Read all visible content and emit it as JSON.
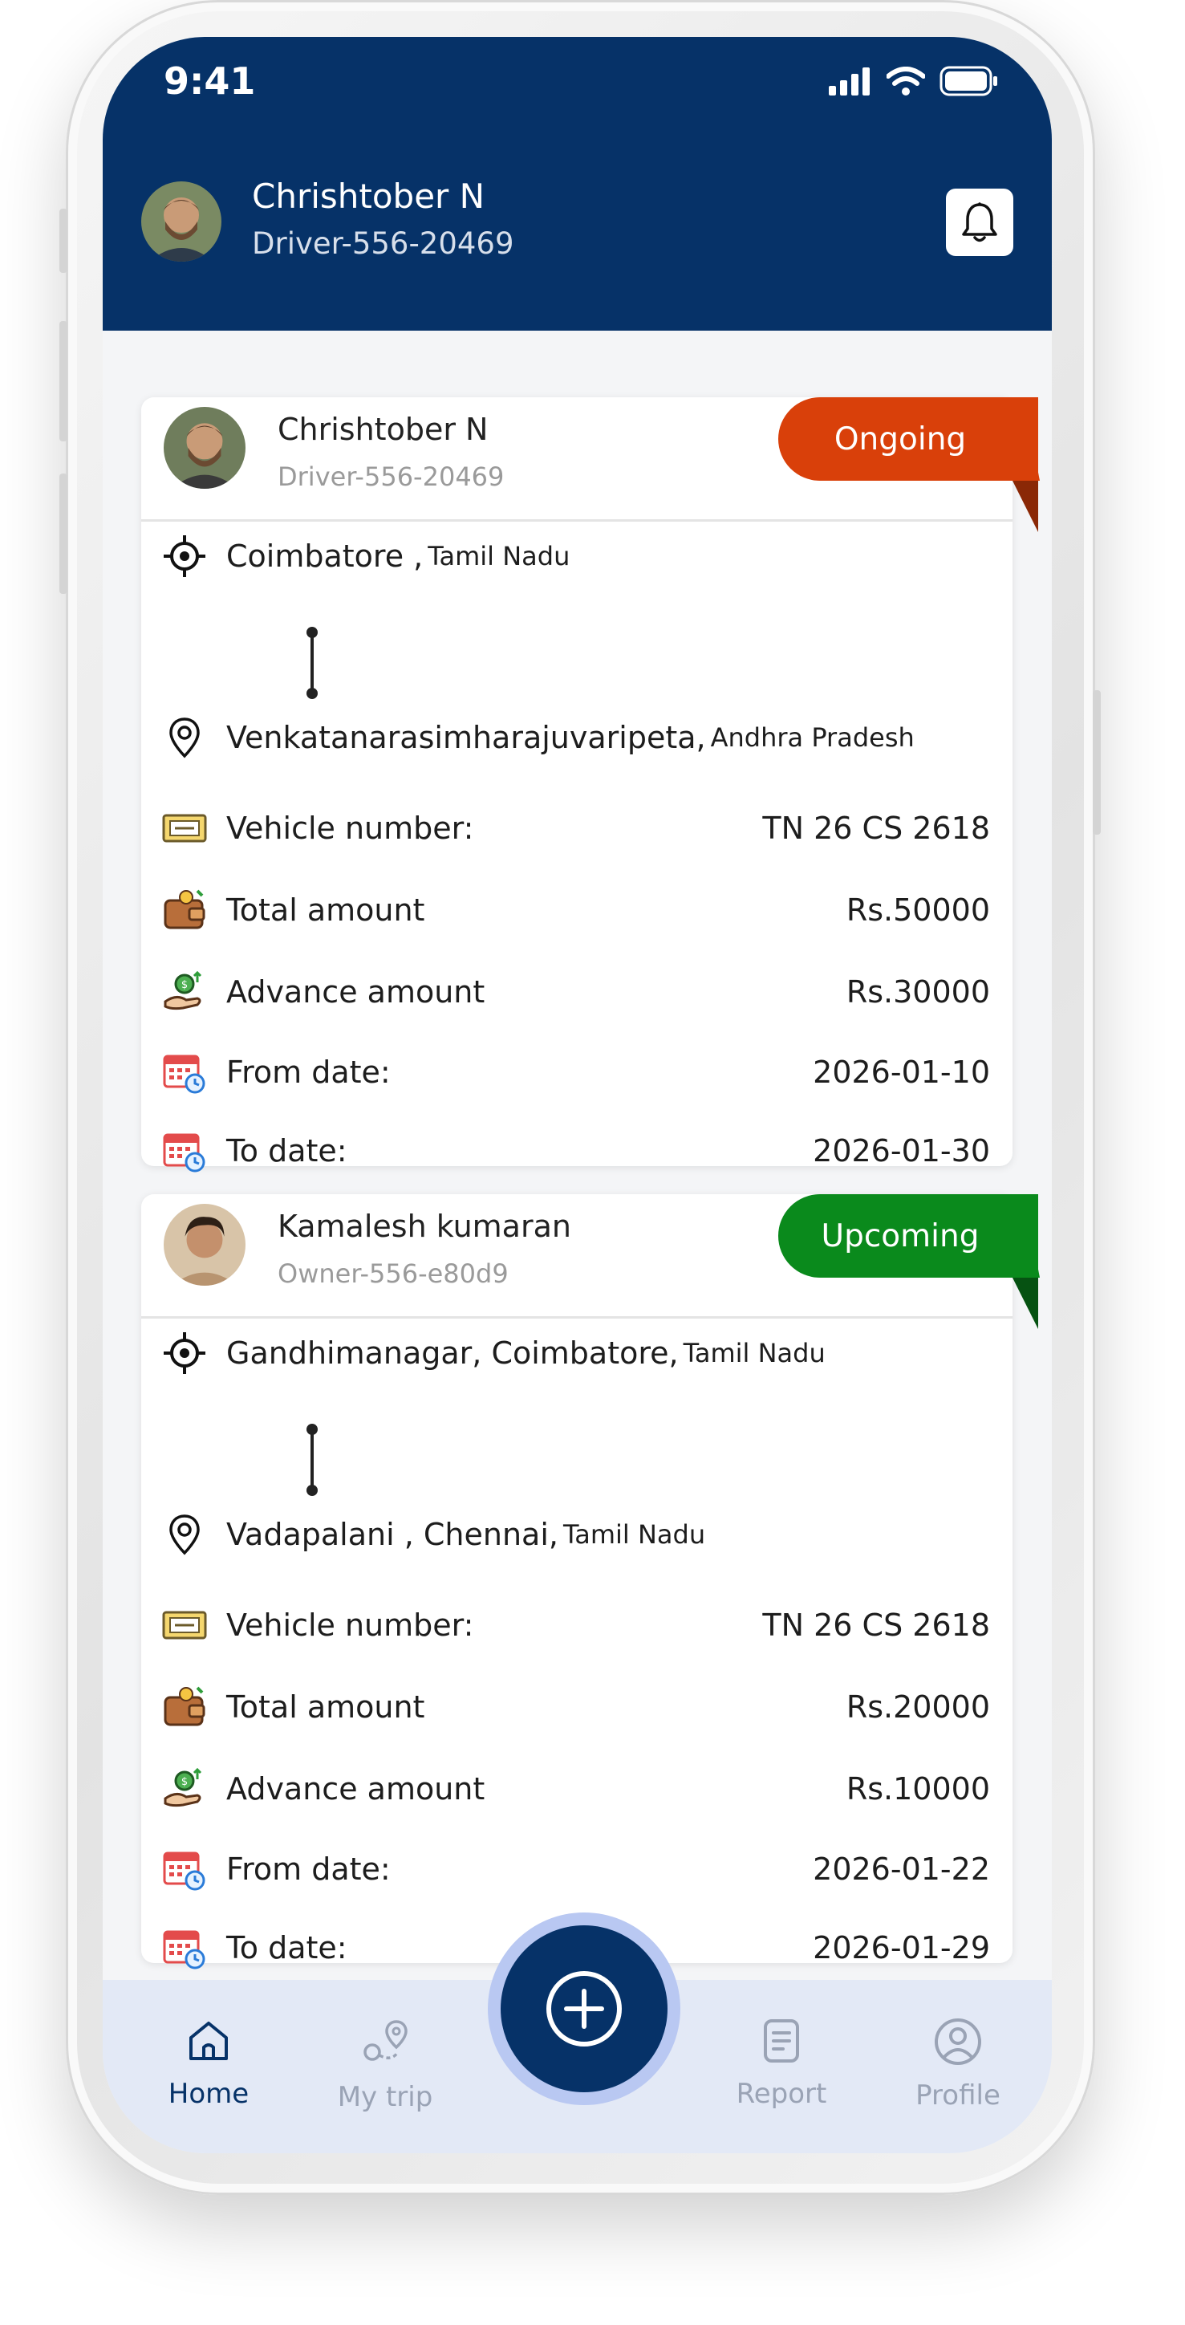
{
  "status_bar": {
    "time": "9:41"
  },
  "header": {
    "name": "Chrishtober N",
    "id": "Driver-556-20469"
  },
  "trips": [
    {
      "name": "Chrishtober N",
      "sub": "Driver-556-20469",
      "status": "Ongoing",
      "status_color": "#d9400a",
      "from_main": "Coimbatore ,",
      "from_state": "Tamil Nadu",
      "to_main": "Venkatanarasimharajuvaripeta,",
      "to_state": "Andhra Pradesh",
      "vehicle_label": "Vehicle number:",
      "vehicle_value": "TN 26 CS 2618",
      "total_label": "Total amount",
      "total_value": "Rs.50000",
      "advance_label": "Advance amount",
      "advance_value": "Rs.30000",
      "from_date_label": "From date:",
      "from_date_value": "2026-01-10",
      "to_date_label": "To date:",
      "to_date_value": "2026-01-30"
    },
    {
      "name": "Kamalesh kumaran",
      "sub": "Owner-556-e80d9",
      "status": "Upcoming",
      "status_color": "#0a8a1c",
      "from_main": "Gandhimanagar, Coimbatore,",
      "from_state": "Tamil Nadu",
      "to_main": "Vadapalani , Chennai,",
      "to_state": "Tamil Nadu",
      "vehicle_label": "Vehicle number:",
      "vehicle_value": "TN 26 CS 2618",
      "total_label": "Total amount",
      "total_value": "Rs.20000",
      "advance_label": "Advance amount",
      "advance_value": "Rs.10000",
      "from_date_label": "From date:",
      "from_date_value": "2026-01-22",
      "to_date_label": "To date:",
      "to_date_value": "2026-01-29"
    }
  ],
  "nav": {
    "home": "Home",
    "my_trip": "My trip",
    "report": "Report",
    "profile": "Profile",
    "active_color": "#063268",
    "inactive_color": "#9aa3b5"
  },
  "icons": [
    "signal-icon",
    "wifi-icon",
    "battery-icon",
    "bell-icon",
    "target-icon",
    "location-pin-icon",
    "vehicle-plate-icon",
    "wallet-icon",
    "money-hand-icon",
    "calendar-icon",
    "home-icon",
    "route-icon",
    "report-icon",
    "profile-icon",
    "plus-icon"
  ]
}
